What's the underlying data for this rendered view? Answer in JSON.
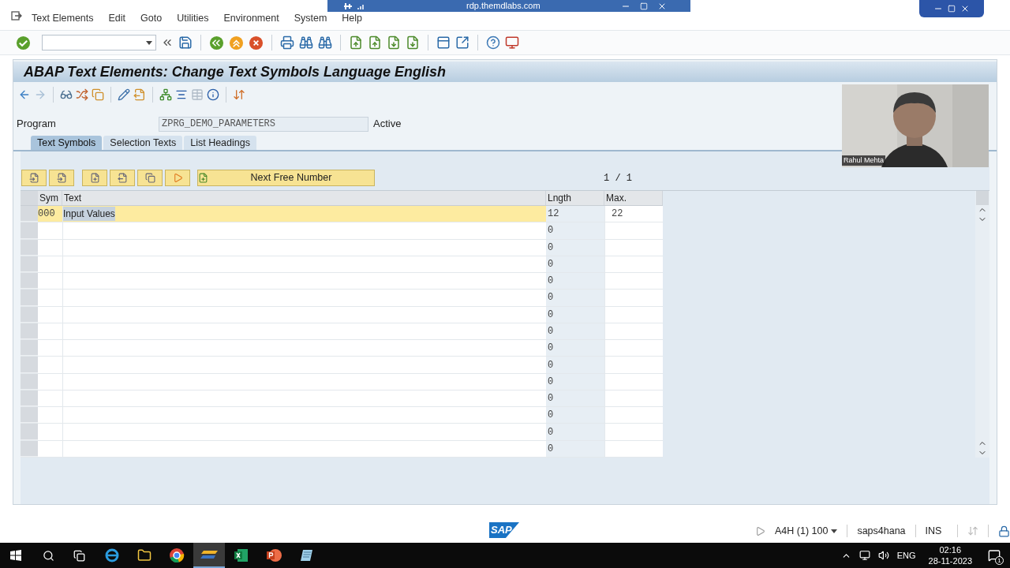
{
  "remote_bar": {
    "title": "rdp.themdlabs.com"
  },
  "menu": [
    "Text Elements",
    "Edit",
    "Goto",
    "Utilities",
    "Environment",
    "System",
    "Help"
  ],
  "title": "ABAP Text Elements: Change Text Symbols Language English",
  "program": {
    "label": "Program",
    "value": "ZPRG_DEMO_PARAMETERS",
    "status": "Active"
  },
  "tabs": [
    {
      "label": "Text Symbols",
      "selected": true
    },
    {
      "label": "Selection Texts",
      "selected": false
    },
    {
      "label": "List Headings",
      "selected": false
    }
  ],
  "next_button": "Next Free Number",
  "page_counter": "1 / 1",
  "table": {
    "columns": [
      "Sym",
      "Text",
      "Lngth",
      "Max."
    ],
    "rows": [
      {
        "sym": "000",
        "text": "Input Values",
        "length": "12",
        "max": "22",
        "selected": true
      },
      {
        "length": "0",
        "selected": false
      },
      {
        "length": "0",
        "selected": false
      },
      {
        "length": "0",
        "selected": false
      },
      {
        "length": "0",
        "selected": false
      },
      {
        "length": "0",
        "selected": false
      },
      {
        "length": "0",
        "selected": false
      },
      {
        "length": "0",
        "selected": false
      },
      {
        "length": "0",
        "selected": false
      },
      {
        "length": "0",
        "selected": false
      },
      {
        "length": "0",
        "selected": false
      },
      {
        "length": "0",
        "selected": false
      },
      {
        "length": "0",
        "selected": false
      },
      {
        "length": "0",
        "selected": false
      },
      {
        "length": "0",
        "selected": false
      }
    ]
  },
  "webcam": {
    "name": "Rahul Mehta"
  },
  "status_bar": {
    "logo": "SAP",
    "system": "A4H (1) 100",
    "server": "saps4hana",
    "mode": "INS"
  },
  "taskbar": {
    "language": "ENG",
    "time": "02:16",
    "date": "28-11-2023",
    "notifications": "1"
  }
}
